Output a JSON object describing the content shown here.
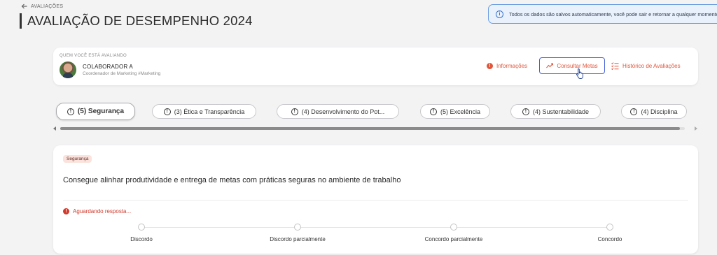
{
  "header": {
    "back_label": "AVALIAÇÕES",
    "title": "AVALIAÇÃO DE DESEMPENHO 2024"
  },
  "notice": {
    "text": "Todos os dados são salvos automaticamente, você pode sair e retornar a qualquer momento"
  },
  "evaluatee": {
    "section_label": "QUEM VOCÊ ESTÁ AVALIANDO",
    "name": "COLABORADOR A",
    "role": "Coordenador de Marketing #Marketing"
  },
  "actions": {
    "info": "Informações",
    "goals": "Consultar Metas",
    "history": "Histórico de Avaliações"
  },
  "tabs": [
    {
      "label": "(5) Segurança",
      "active": true
    },
    {
      "label": "(3) Ética e Transparência",
      "active": false
    },
    {
      "label": "(4) Desenvolvimento do Pot...",
      "active": false
    },
    {
      "label": "(5) Excelência",
      "active": false
    },
    {
      "label": "(4) Sustentabilidade",
      "active": false
    },
    {
      "label": "(4) Disciplina",
      "active": false
    }
  ],
  "question": {
    "category": "Segurança",
    "text": "Consegue alinhar produtividade e entrega de metas com práticas seguras no ambiente de trabalho",
    "status": "Aguardando resposta...",
    "options": [
      "Discordo",
      "Discordo parcialmente",
      "Concordo parcialmente",
      "Concordo"
    ]
  },
  "colors": {
    "accent": "#e2553b",
    "focus": "#4863d8",
    "info_border": "#6a9ce0",
    "error": "#d23a2c"
  }
}
